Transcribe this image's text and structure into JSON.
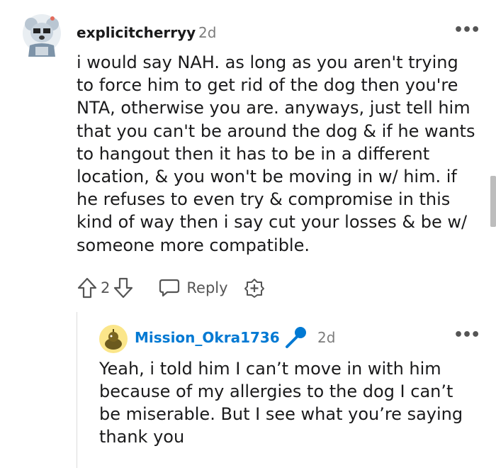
{
  "comment": {
    "username": "explicitcherryy",
    "age": "2d",
    "more_label": "•••",
    "body": "i would say NAH. as long as you aren't trying\nto force him to get rid of the dog then you're\nNTA, otherwise you are. anyways, just tell him\nthat you can't be around the dog & if he wants\nto hangout then it has to be in a different\nlocation, & you won't be moving in w/ him. if\nhe refuses to even try & compromise in this\nkind of way then i say cut your losses & be w/\nsomeone more compatible.",
    "vote_count": "2",
    "reply_label": "Reply",
    "icons": [
      "avatar-icon",
      "upvote-icon",
      "downvote-icon",
      "reply-icon",
      "award-icon",
      "more-icon"
    ]
  },
  "reply": {
    "username": "Mission_Okra1736",
    "age": "2d",
    "more_label": "•••",
    "body": "Yeah, i told him I can’t move in with him\nbecause of my allergies to the dog I can’t\nbe miserable. But I see what you’re saying\nthank you",
    "icons": [
      "avatar-icon",
      "microphone-icon",
      "more-icon"
    ]
  },
  "colors": {
    "username_reply": "#0079d3",
    "text": "#1a1a1b",
    "meta": "#7c7c7c"
  }
}
